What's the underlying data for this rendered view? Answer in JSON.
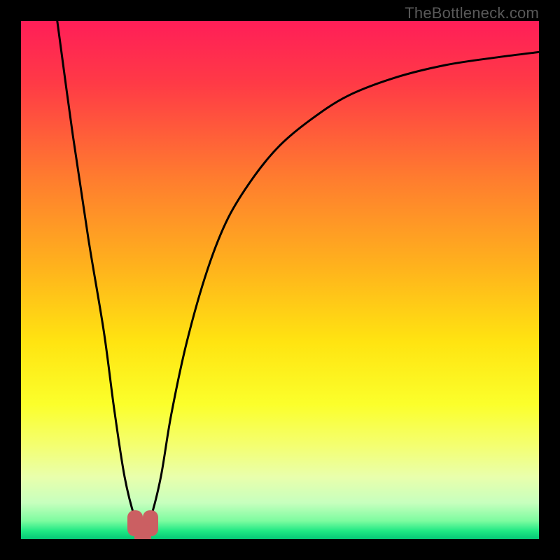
{
  "watermark": "TheBottleneck.com",
  "chart_data": {
    "type": "line",
    "title": "",
    "xlabel": "",
    "ylabel": "",
    "xlim": [
      0,
      100
    ],
    "ylim": [
      0,
      100
    ],
    "series": [
      {
        "name": "curve",
        "x": [
          7,
          10,
          13,
          16,
          18,
          20,
          22,
          23.5,
          25,
          27,
          29,
          32,
          36,
          40,
          45,
          50,
          56,
          63,
          72,
          82,
          92,
          100
        ],
        "y": [
          100,
          78,
          58,
          40,
          25,
          12,
          4,
          1,
          4,
          12,
          24,
          38,
          52,
          62,
          70,
          76,
          81,
          85.5,
          89,
          91.5,
          93,
          94
        ]
      }
    ],
    "gradient_stops": [
      {
        "pos": 0.0,
        "color": "#ff1e58"
      },
      {
        "pos": 0.12,
        "color": "#ff3a46"
      },
      {
        "pos": 0.3,
        "color": "#ff7b2f"
      },
      {
        "pos": 0.48,
        "color": "#ffb41c"
      },
      {
        "pos": 0.62,
        "color": "#ffe411"
      },
      {
        "pos": 0.74,
        "color": "#fbff2b"
      },
      {
        "pos": 0.82,
        "color": "#f4ff71"
      },
      {
        "pos": 0.88,
        "color": "#e9ffac"
      },
      {
        "pos": 0.93,
        "color": "#c7ffbe"
      },
      {
        "pos": 0.965,
        "color": "#7dfca0"
      },
      {
        "pos": 0.985,
        "color": "#1de883"
      },
      {
        "pos": 1.0,
        "color": "#06c776"
      }
    ],
    "trough_markers": [
      {
        "x": 22.0,
        "y": 3.0,
        "w": 3.0,
        "h": 5.0,
        "r": 10
      },
      {
        "x": 25.0,
        "y": 3.0,
        "w": 3.0,
        "h": 5.0,
        "r": 10
      },
      {
        "x": 23.5,
        "y": 1.0,
        "w": 3.2,
        "h": 3.5,
        "r": 8
      }
    ]
  }
}
